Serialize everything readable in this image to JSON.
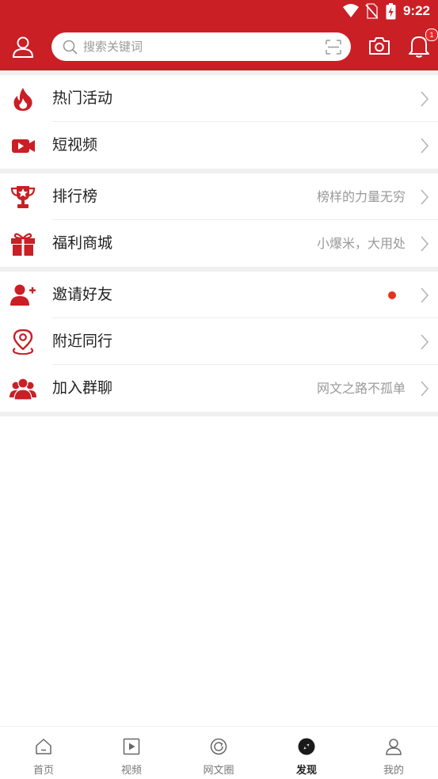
{
  "status_bar": {
    "time": "9:22"
  },
  "header": {
    "search_placeholder": "搜索关键词",
    "notification_count": "1"
  },
  "menu_groups": [
    [
      {
        "icon": "flame-icon",
        "title": "热门活动",
        "subtitle": ""
      },
      {
        "icon": "video-icon",
        "title": "短视频",
        "subtitle": ""
      }
    ],
    [
      {
        "icon": "trophy-icon",
        "title": "排行榜",
        "subtitle": "榜样的力量无穷"
      },
      {
        "icon": "gift-icon",
        "title": "福利商城",
        "subtitle": "小爆米，大用处"
      }
    ],
    [
      {
        "icon": "add-user-icon",
        "title": "邀请好友",
        "subtitle": "",
        "dot": true
      },
      {
        "icon": "location-pin-icon",
        "title": "附近同行",
        "subtitle": ""
      },
      {
        "icon": "group-icon",
        "title": "加入群聊",
        "subtitle": "网文之路不孤单"
      }
    ]
  ],
  "bottom_nav": [
    {
      "icon": "home-icon",
      "label": "首页"
    },
    {
      "icon": "play-icon",
      "label": "视频"
    },
    {
      "icon": "circle-refresh-icon",
      "label": "网文圈"
    },
    {
      "icon": "discover-icon",
      "label": "发现",
      "active": true
    },
    {
      "icon": "profile-icon",
      "label": "我的"
    }
  ],
  "colors": {
    "brand": "#c91f25",
    "accent_dot": "#e5321d",
    "text": "#222222",
    "subtext": "#999999"
  }
}
